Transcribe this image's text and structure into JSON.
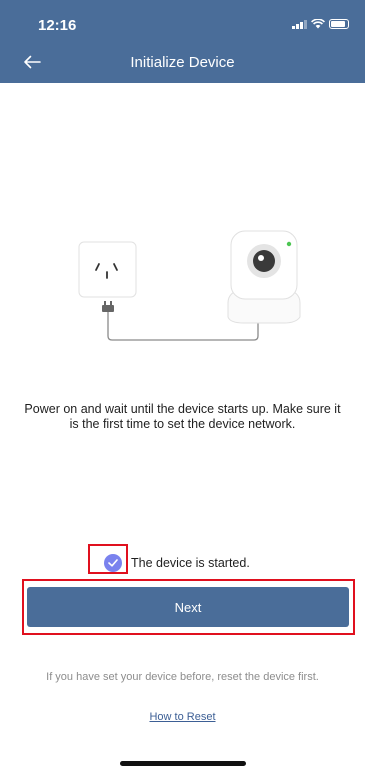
{
  "status_bar": {
    "time": "12:16"
  },
  "header": {
    "title": "Initialize Device",
    "back_icon": "arrow-left-icon"
  },
  "illustration": {
    "socket_icon": "power-socket-icon",
    "camera_icon": "security-camera-icon"
  },
  "instructions": {
    "text": "Power on and wait until the device starts up. Make sure it is the first time to set the device network."
  },
  "device_started": {
    "label": "The device is started.",
    "checked": true,
    "color": "#7a82ee"
  },
  "next_button": {
    "label": "Next",
    "color": "#4a6d99"
  },
  "reset": {
    "hint": "If you have set your device before, reset the device first.",
    "link_label": "How to Reset"
  },
  "colors": {
    "header": "#4a6d99",
    "highlight": "#e0101e"
  }
}
